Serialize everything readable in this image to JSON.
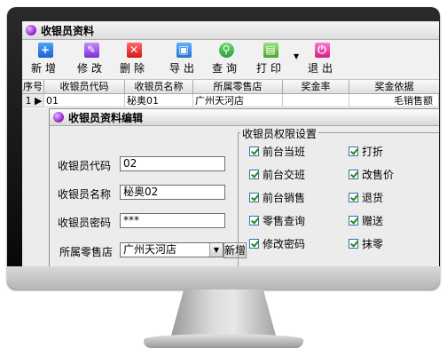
{
  "app": {
    "title": "收银员资料"
  },
  "toolbar": {
    "buttons": [
      {
        "id": "add",
        "label": "新增",
        "icon": "add-icon"
      },
      {
        "id": "edit",
        "label": "修改",
        "icon": "edit-icon"
      },
      {
        "id": "delete",
        "label": "删除",
        "icon": "delete-icon"
      },
      {
        "id": "export",
        "label": "导出",
        "icon": "export-icon"
      },
      {
        "id": "query",
        "label": "查询",
        "icon": "search-icon"
      },
      {
        "id": "print",
        "label": "打印",
        "icon": "printer-icon"
      },
      {
        "id": "exit",
        "label": "退出",
        "icon": "power-icon"
      }
    ]
  },
  "grid": {
    "headers": [
      "序号",
      "收银员代码",
      "收银员名称",
      "所属零售店",
      "奖金率",
      "奖金依据"
    ],
    "rows": [
      {
        "index": "1",
        "code": "01",
        "name": "秘奥01",
        "store": "广州天河店",
        "rate": "",
        "basis": "毛销售额"
      }
    ]
  },
  "dialog": {
    "title": "收银员资料编辑",
    "fields": {
      "code_label": "收银员代码",
      "code_value": "02",
      "name_label": "收银员名称",
      "name_value": "秘奥02",
      "password_label": "收银员密码",
      "password_value": "***",
      "store_label": "所属零售店",
      "store_value": "广州天河店",
      "new_button": "新增"
    },
    "permissions": {
      "legend": "收银员权限设置",
      "left": [
        "前台当班",
        "前台交班",
        "前台销售",
        "零售查询",
        "修改密码"
      ],
      "right": [
        "打折",
        "改售价",
        "退货",
        "赠送",
        "抹零"
      ]
    }
  }
}
